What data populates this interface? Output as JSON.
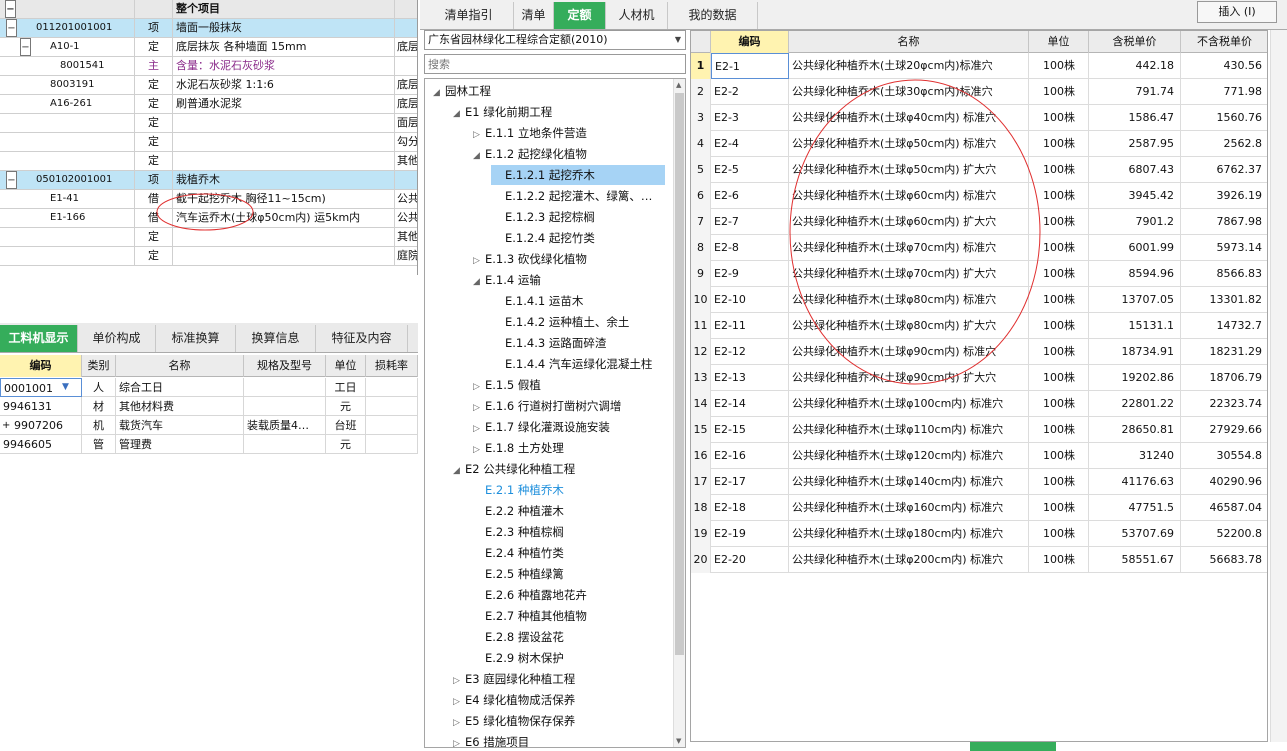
{
  "left_table": {
    "header": "整个项目",
    "rows": [
      {
        "expand": "−",
        "code": "011201001001",
        "type": "项",
        "name": "墙面一般抹灰",
        "extra": "",
        "selected": true,
        "indent": 0
      },
      {
        "expand": "−",
        "code": "A10-1",
        "type": "定",
        "name": "底层抹灰 各种墙面 15mm",
        "extra": "底层",
        "selected": false,
        "indent": 1
      },
      {
        "expand": "",
        "code": "8001541",
        "type": "主",
        "name": "含量：水泥石灰砂浆",
        "extra": "",
        "selected": false,
        "indent": 2,
        "purple": true
      },
      {
        "expand": "",
        "code": "8003191",
        "type": "定",
        "name": "水泥石灰砂浆 1:1:6",
        "extra": "底层",
        "selected": false,
        "indent": 1
      },
      {
        "expand": "",
        "code": "A16-261",
        "type": "定",
        "name": "刷普通水泥浆",
        "extra": "底层",
        "selected": false,
        "indent": 1
      },
      {
        "expand": "",
        "code": "",
        "type": "定",
        "name": "",
        "extra": "面层",
        "selected": false,
        "indent": 1
      },
      {
        "expand": "",
        "code": "",
        "type": "定",
        "name": "",
        "extra": "勾分",
        "selected": false,
        "indent": 1
      },
      {
        "expand": "",
        "code": "",
        "type": "定",
        "name": "",
        "extra": "其他",
        "selected": false,
        "indent": 1
      },
      {
        "expand": "−",
        "code": "050102001001",
        "type": "项",
        "name": "栽植乔木",
        "extra": "",
        "selected": true,
        "indent": 0
      },
      {
        "expand": "",
        "code": "E1-41",
        "type": "借",
        "name": "截干起挖乔木 胸径11~15cm)",
        "extra": "公共",
        "selected": false,
        "indent": 1
      },
      {
        "expand": "",
        "code": "E1-166",
        "type": "借",
        "name": "汽车运乔木(土球φ50cm内) 运5km内",
        "extra": "公共",
        "selected": false,
        "indent": 1
      },
      {
        "expand": "",
        "code": "",
        "type": "定",
        "name": "",
        "extra": "其他",
        "selected": false,
        "indent": 1
      },
      {
        "expand": "",
        "code": "",
        "type": "定",
        "name": "",
        "extra": "庭院",
        "selected": false,
        "indent": 1
      }
    ]
  },
  "lower_tabs": [
    "工料机显示",
    "单价构成",
    "标准换算",
    "换算信息",
    "特征及内容"
  ],
  "lower_table": {
    "headers": [
      "编码",
      "类别",
      "名称",
      "规格及型号",
      "单位",
      "损耗率"
    ],
    "rows": [
      {
        "code": "0001001",
        "type": "人",
        "name": "综合工日",
        "spec": "",
        "unit": "工日",
        "expand": ""
      },
      {
        "code": "9946131",
        "type": "材",
        "name": "其他材料费",
        "spec": "",
        "unit": "元",
        "expand": ""
      },
      {
        "code": "9907206",
        "type": "机",
        "name": "载货汽车",
        "spec": "装载质量4…",
        "unit": "台班",
        "expand": "+"
      },
      {
        "code": "9946605",
        "type": "管",
        "name": "管理费",
        "spec": "",
        "unit": "元",
        "expand": ""
      }
    ]
  },
  "top_tabs": [
    "清单指引",
    "清单",
    "定额",
    "人材机",
    "我的数据"
  ],
  "insert_button": "插入 (I)",
  "dropdown_value": "广东省园林绿化工程综合定额(2010)",
  "search_placeholder": "搜索",
  "tree": [
    {
      "label": "园林工程",
      "level": 0,
      "arrow": "◢"
    },
    {
      "label": "E1 绿化前期工程",
      "level": 1,
      "arrow": "◢"
    },
    {
      "label": "E.1.1 立地条件营造",
      "level": 2,
      "arrow": "▷"
    },
    {
      "label": "E.1.2 起挖绿化植物",
      "level": 2,
      "arrow": "◢"
    },
    {
      "label": "E.1.2.1 起挖乔木",
      "level": 3,
      "arrow": "",
      "selected": true
    },
    {
      "label": "E.1.2.2 起挖灌木、绿篱、…",
      "level": 3,
      "arrow": ""
    },
    {
      "label": "E.1.2.3 起挖棕榈",
      "level": 3,
      "arrow": ""
    },
    {
      "label": "E.1.2.4 起挖竹类",
      "level": 3,
      "arrow": ""
    },
    {
      "label": "E.1.3 砍伐绿化植物",
      "level": 2,
      "arrow": "▷"
    },
    {
      "label": "E.1.4 运输",
      "level": 2,
      "arrow": "◢"
    },
    {
      "label": "E.1.4.1 运苗木",
      "level": 3,
      "arrow": ""
    },
    {
      "label": "E.1.4.2 运种植土、余土",
      "level": 3,
      "arrow": ""
    },
    {
      "label": "E.1.4.3 运路面碎渣",
      "level": 3,
      "arrow": ""
    },
    {
      "label": "E.1.4.4 汽车运绿化混凝土柱",
      "level": 3,
      "arrow": ""
    },
    {
      "label": "E.1.5 假植",
      "level": 2,
      "arrow": "▷"
    },
    {
      "label": "E.1.6 行道树打凿树穴调增",
      "level": 2,
      "arrow": "▷"
    },
    {
      "label": "E.1.7 绿化灌溉设施安装",
      "level": 2,
      "arrow": "▷"
    },
    {
      "label": "E.1.8 土方处理",
      "level": 2,
      "arrow": "▷"
    },
    {
      "label": "E2 公共绿化种植工程",
      "level": 1,
      "arrow": "◢"
    },
    {
      "label": "E.2.1 种植乔木",
      "level": 2,
      "arrow": "",
      "blue": true
    },
    {
      "label": "E.2.2 种植灌木",
      "level": 2,
      "arrow": ""
    },
    {
      "label": "E.2.3 种植棕榈",
      "level": 2,
      "arrow": ""
    },
    {
      "label": "E.2.4 种植竹类",
      "level": 2,
      "arrow": ""
    },
    {
      "label": "E.2.5 种植绿篱",
      "level": 2,
      "arrow": ""
    },
    {
      "label": "E.2.6 种植露地花卉",
      "level": 2,
      "arrow": ""
    },
    {
      "label": "E.2.7 种植其他植物",
      "level": 2,
      "arrow": ""
    },
    {
      "label": "E.2.8 摆设盆花",
      "level": 2,
      "arrow": ""
    },
    {
      "label": "E.2.9 树木保护",
      "level": 2,
      "arrow": ""
    },
    {
      "label": "E3 庭园绿化种植工程",
      "level": 1,
      "arrow": "▷"
    },
    {
      "label": "E4 绿化植物成活保养",
      "level": 1,
      "arrow": "▷"
    },
    {
      "label": "E5 绿化植物保存保养",
      "level": 1,
      "arrow": "▷"
    },
    {
      "label": "E6 措施项目",
      "level": 1,
      "arrow": "▷"
    }
  ],
  "quota_table": {
    "headers": [
      "",
      "编码",
      "名称",
      "单位",
      "含税单价",
      "不含税单价"
    ],
    "rows": [
      {
        "n": "1",
        "code": "E2-1",
        "name": "公共绿化种植乔木(土球20φcm内)标准穴",
        "unit": "100株",
        "tax": "442.18",
        "notax": "430.56"
      },
      {
        "n": "2",
        "code": "E2-2",
        "name": "公共绿化种植乔木(土球30φcm内)标准穴",
        "unit": "100株",
        "tax": "791.74",
        "notax": "771.98"
      },
      {
        "n": "3",
        "code": "E2-3",
        "name": "公共绿化种植乔木(土球φ40cm内) 标准穴",
        "unit": "100株",
        "tax": "1586.47",
        "notax": "1560.76"
      },
      {
        "n": "4",
        "code": "E2-4",
        "name": "公共绿化种植乔木(土球φ50cm内) 标准穴",
        "unit": "100株",
        "tax": "2587.95",
        "notax": "2562.8"
      },
      {
        "n": "5",
        "code": "E2-5",
        "name": "公共绿化种植乔木(土球φ50cm内) 扩大穴",
        "unit": "100株",
        "tax": "6807.43",
        "notax": "6762.37"
      },
      {
        "n": "6",
        "code": "E2-6",
        "name": "公共绿化种植乔木(土球φ60cm内) 标准穴",
        "unit": "100株",
        "tax": "3945.42",
        "notax": "3926.19"
      },
      {
        "n": "7",
        "code": "E2-7",
        "name": "公共绿化种植乔木(土球φ60cm内) 扩大穴",
        "unit": "100株",
        "tax": "7901.2",
        "notax": "7867.98"
      },
      {
        "n": "8",
        "code": "E2-8",
        "name": "公共绿化种植乔木(土球φ70cm内) 标准穴",
        "unit": "100株",
        "tax": "6001.99",
        "notax": "5973.14"
      },
      {
        "n": "9",
        "code": "E2-9",
        "name": "公共绿化种植乔木(土球φ70cm内) 扩大穴",
        "unit": "100株",
        "tax": "8594.96",
        "notax": "8566.83"
      },
      {
        "n": "10",
        "code": "E2-10",
        "name": "公共绿化种植乔木(土球φ80cm内) 标准穴",
        "unit": "100株",
        "tax": "13707.05",
        "notax": "13301.82"
      },
      {
        "n": "11",
        "code": "E2-11",
        "name": "公共绿化种植乔木(土球φ80cm内) 扩大穴",
        "unit": "100株",
        "tax": "15131.1",
        "notax": "14732.7"
      },
      {
        "n": "12",
        "code": "E2-12",
        "name": "公共绿化种植乔木(土球φ90cm内) 标准穴",
        "unit": "100株",
        "tax": "18734.91",
        "notax": "18231.29"
      },
      {
        "n": "13",
        "code": "E2-13",
        "name": "公共绿化种植乔木(土球φ90cm内) 扩大穴",
        "unit": "100株",
        "tax": "19202.86",
        "notax": "18706.79"
      },
      {
        "n": "14",
        "code": "E2-14",
        "name": "公共绿化种植乔木(土球φ100cm内) 标准穴",
        "unit": "100株",
        "tax": "22801.22",
        "notax": "22323.74"
      },
      {
        "n": "15",
        "code": "E2-15",
        "name": "公共绿化种植乔木(土球φ110cm内) 标准穴",
        "unit": "100株",
        "tax": "28650.81",
        "notax": "27929.66"
      },
      {
        "n": "16",
        "code": "E2-16",
        "name": "公共绿化种植乔木(土球φ120cm内) 标准穴",
        "unit": "100株",
        "tax": "31240",
        "notax": "30554.8"
      },
      {
        "n": "17",
        "code": "E2-17",
        "name": "公共绿化种植乔木(土球φ140cm内) 标准穴",
        "unit": "100株",
        "tax": "41176.63",
        "notax": "40290.96"
      },
      {
        "n": "18",
        "code": "E2-18",
        "name": "公共绿化种植乔木(土球φ160cm内) 标准穴",
        "unit": "100株",
        "tax": "47751.5",
        "notax": "46587.04"
      },
      {
        "n": "19",
        "code": "E2-19",
        "name": "公共绿化种植乔木(土球φ180cm内) 标准穴",
        "unit": "100株",
        "tax": "53707.69",
        "notax": "52200.8"
      },
      {
        "n": "20",
        "code": "E2-20",
        "name": "公共绿化种植乔木(土球φ200cm内) 标准穴",
        "unit": "100株",
        "tax": "58551.67",
        "notax": "56683.78"
      }
    ]
  },
  "colors": {
    "accent": "#35ad5b",
    "selection": "#bfe4f6",
    "annotation": "#e03030"
  }
}
